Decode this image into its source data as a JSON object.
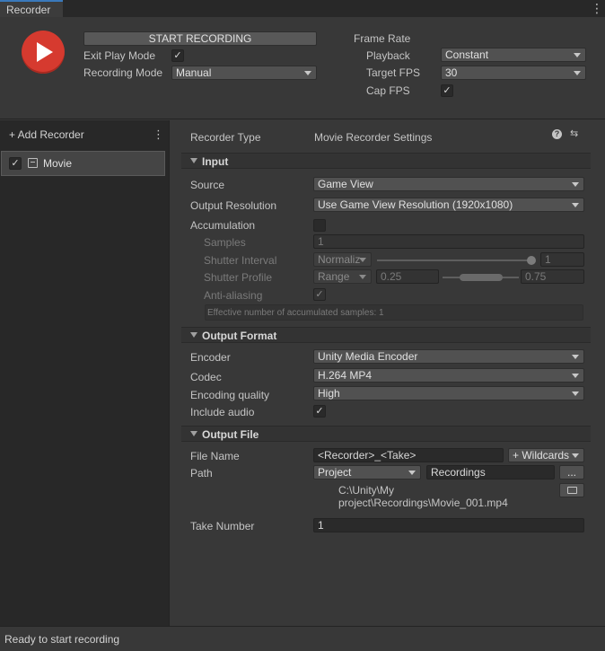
{
  "window": {
    "tab_title": "Recorder",
    "menu_icon": "kebab-menu-icon"
  },
  "top": {
    "record_icon": "play-icon",
    "start_recording": "START RECORDING",
    "exit_play_mode_label": "Exit Play Mode",
    "exit_play_mode_checked": true,
    "recording_mode_label": "Recording Mode",
    "recording_mode_value": "Manual",
    "frame_rate_label": "Frame Rate",
    "playback_label": "Playback",
    "playback_value": "Constant",
    "target_fps_label": "Target FPS",
    "target_fps_value": "30",
    "cap_fps_label": "Cap FPS",
    "cap_fps_checked": true
  },
  "sidebar": {
    "add_recorder": "+ Add Recorder",
    "items": [
      {
        "label": "Movie",
        "enabled": true,
        "icon": "movie-icon"
      }
    ]
  },
  "settings": {
    "recorder_type_label": "Recorder Type",
    "recorder_type_value": "Movie Recorder Settings",
    "help_icon": "help-icon",
    "presets_icon": "presets-icon",
    "input": {
      "header": "Input",
      "source_label": "Source",
      "source_value": "Game View",
      "output_resolution_label": "Output Resolution",
      "output_resolution_value": "Use Game View Resolution (1920x1080)",
      "accumulation_label": "Accumulation",
      "accumulation_checked": false,
      "samples_label": "Samples",
      "samples_value": "1",
      "shutter_interval_label": "Shutter Interval",
      "shutter_interval_mode": "Normaliz",
      "shutter_interval_value": "1",
      "shutter_interval_fraction": 1.0,
      "shutter_profile_label": "Shutter Profile",
      "shutter_profile_mode": "Range",
      "shutter_profile_min": "0.25",
      "shutter_profile_max": "0.75",
      "anti_aliasing_label": "Anti-aliasing",
      "anti_aliasing_checked": true,
      "effective_samples_text": "Effective number of accumulated samples: 1"
    },
    "output_format": {
      "header": "Output Format",
      "encoder_label": "Encoder",
      "encoder_value": "Unity Media Encoder",
      "codec_label": "Codec",
      "codec_value": "H.264 MP4",
      "encoding_quality_label": "Encoding quality",
      "encoding_quality_value": "High",
      "include_audio_label": "Include audio",
      "include_audio_checked": true
    },
    "output_file": {
      "header": "Output File",
      "file_name_label": "File Name",
      "file_name_value": "<Recorder>_<Take>",
      "wildcards_button": "+ Wildcards",
      "path_label": "Path",
      "path_root_value": "Project",
      "path_folder_value": "Recordings",
      "browse_button": "...",
      "open_folder_icon": "open-folder-icon",
      "resolved_path_line1": "C:\\Unity\\My",
      "resolved_path_line2": "project\\Recordings\\Movie_001.mp4",
      "take_number_label": "Take Number",
      "take_number_value": "1"
    }
  },
  "status": {
    "text": "Ready to start recording"
  }
}
